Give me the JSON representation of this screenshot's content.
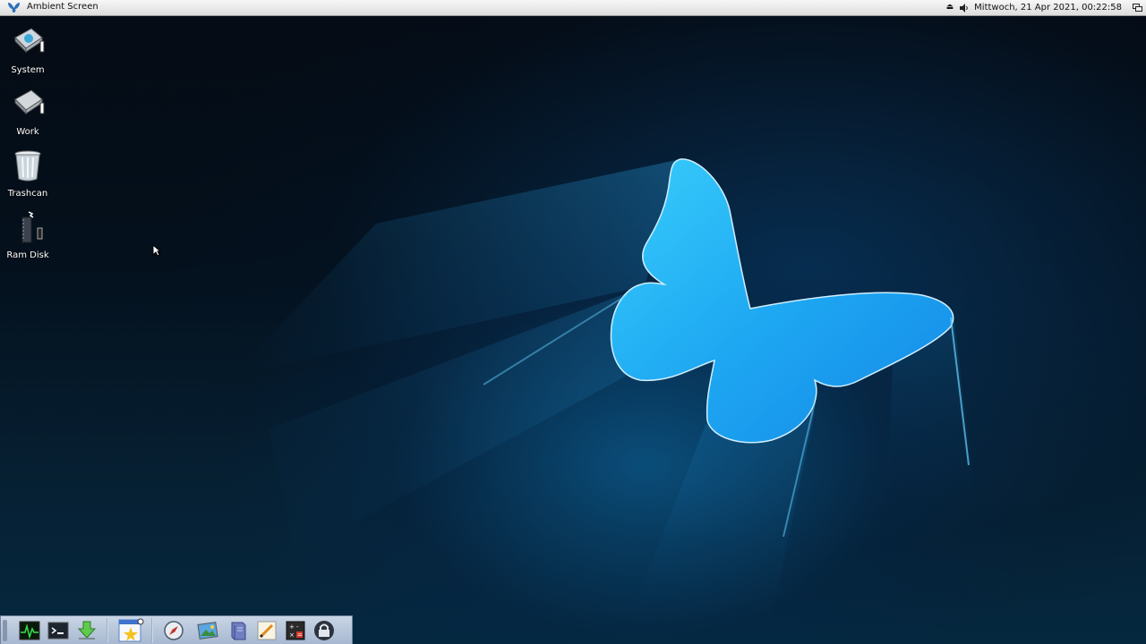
{
  "menubar": {
    "title": "Ambient Screen",
    "clock": "Mittwoch, 21 Apr 2021, 00:22:58",
    "eject_icon": "eject-icon",
    "volume_icon": "volume-icon",
    "screens_icon": "screens-icon"
  },
  "desktop": {
    "icons": [
      {
        "label": "System",
        "icon": "hard-drive-icon"
      },
      {
        "label": "Work",
        "icon": "hard-drive-icon"
      },
      {
        "label": "Trashcan",
        "icon": "trashcan-icon"
      },
      {
        "label": "Ram Disk",
        "icon": "ram-disk-icon"
      }
    ]
  },
  "dock": {
    "items": [
      {
        "name": "system-monitor",
        "icon": "activity-monitor-icon"
      },
      {
        "name": "shell",
        "icon": "terminal-icon"
      },
      {
        "name": "downloader",
        "icon": "download-arrow-icon"
      },
      {
        "name": "notes",
        "icon": "notepad-star-icon"
      },
      {
        "name": "browser",
        "icon": "compass-icon"
      },
      {
        "name": "image-viewer",
        "icon": "picture-icon"
      },
      {
        "name": "books",
        "icon": "book-icon"
      },
      {
        "name": "text-editor",
        "icon": "pen-icon"
      },
      {
        "name": "calculator",
        "icon": "calculator-icon"
      },
      {
        "name": "lock-screen",
        "icon": "lock-icon"
      }
    ]
  },
  "colors": {
    "menubar_bg": "#e6e6e6",
    "desktop_bg": "#04101c",
    "butterfly": "#1d9fe8",
    "dock_bg": "#b8c6da"
  }
}
